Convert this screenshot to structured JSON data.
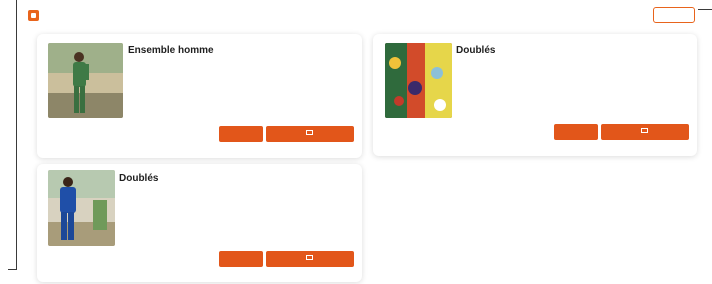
{
  "header": {
    "brand": "",
    "top_button": ""
  },
  "colors": {
    "accent": "#e2561a",
    "brand": "#e8641c"
  },
  "products": [
    {
      "title": "Ensemble homme",
      "description": "",
      "price": "",
      "detail_label": "",
      "cart_label": "",
      "photo": "man-green-outfit"
    },
    {
      "title": "Doublés",
      "description": "",
      "price": "",
      "detail_label": "",
      "cart_label": "",
      "photo": "patterned-fabric"
    },
    {
      "title": "Doublés",
      "description": "",
      "price": "",
      "detail_label": "",
      "cart_label": "",
      "photo": "man-blue-outfit"
    }
  ]
}
